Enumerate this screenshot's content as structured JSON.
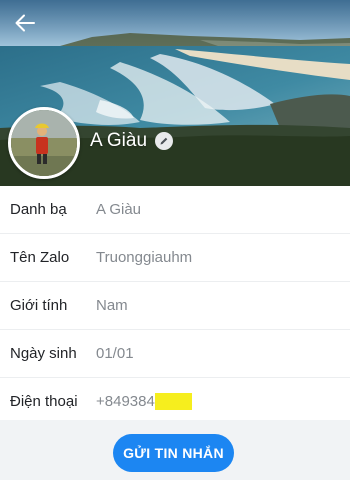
{
  "profile": {
    "name": "A Giàu",
    "back_icon": "arrow-left-icon",
    "edit_icon": "pencil-icon"
  },
  "info_rows": [
    {
      "label": "Danh bạ",
      "value": "A Giàu"
    },
    {
      "label": "Tên Zalo",
      "value": "Truonggiauhm"
    },
    {
      "label": "Giới tính",
      "value": "Nam"
    },
    {
      "label": "Ngày sinh",
      "value": "01/01"
    },
    {
      "label": "Điện thoại",
      "value": "+849384",
      "value_masked": "xxxxx"
    }
  ],
  "actions": {
    "send_message": "GỬI TIN NHẮN"
  },
  "colors": {
    "accent": "#1c86f2",
    "highlight": "#f6ee1e"
  }
}
